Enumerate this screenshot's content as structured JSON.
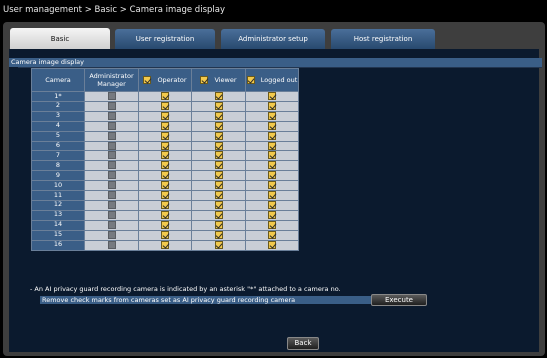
{
  "breadcrumb": "User management > Basic > Camera image display",
  "tabs": [
    {
      "label": "Basic",
      "active": true
    },
    {
      "label": "User registration",
      "active": false
    },
    {
      "label": "Administrator setup",
      "active": false
    },
    {
      "label": "Host registration",
      "active": false
    }
  ],
  "section_title": "Camera image display",
  "table": {
    "columns": {
      "camera": "Camera",
      "admin_line1": "Administrator",
      "admin_line2": "Manager",
      "operator": "Operator",
      "viewer": "Viewer",
      "logged_out": "Logged out"
    },
    "rows": [
      {
        "camera": "1*",
        "admin": false,
        "operator": true,
        "viewer": true,
        "logged_out": true
      },
      {
        "camera": "2",
        "admin": false,
        "operator": true,
        "viewer": true,
        "logged_out": true
      },
      {
        "camera": "3",
        "admin": false,
        "operator": true,
        "viewer": true,
        "logged_out": true
      },
      {
        "camera": "4",
        "admin": false,
        "operator": true,
        "viewer": true,
        "logged_out": true
      },
      {
        "camera": "5",
        "admin": false,
        "operator": true,
        "viewer": true,
        "logged_out": true
      },
      {
        "camera": "6",
        "admin": false,
        "operator": true,
        "viewer": true,
        "logged_out": true
      },
      {
        "camera": "7",
        "admin": false,
        "operator": true,
        "viewer": true,
        "logged_out": true
      },
      {
        "camera": "8",
        "admin": false,
        "operator": true,
        "viewer": true,
        "logged_out": true
      },
      {
        "camera": "9",
        "admin": false,
        "operator": true,
        "viewer": true,
        "logged_out": true
      },
      {
        "camera": "10",
        "admin": false,
        "operator": true,
        "viewer": true,
        "logged_out": true
      },
      {
        "camera": "11",
        "admin": false,
        "operator": true,
        "viewer": true,
        "logged_out": true
      },
      {
        "camera": "12",
        "admin": false,
        "operator": true,
        "viewer": true,
        "logged_out": true
      },
      {
        "camera": "13",
        "admin": false,
        "operator": true,
        "viewer": true,
        "logged_out": true
      },
      {
        "camera": "14",
        "admin": false,
        "operator": true,
        "viewer": true,
        "logged_out": true
      },
      {
        "camera": "15",
        "admin": false,
        "operator": true,
        "viewer": true,
        "logged_out": true
      },
      {
        "camera": "16",
        "admin": false,
        "operator": true,
        "viewer": true,
        "logged_out": true
      }
    ]
  },
  "note": "- An AI privacy guard recording camera is indicated by an asterisk \"*\" attached to a camera no.",
  "execute_row_label": "Remove check marks from cameras set as AI privacy guard recording camera",
  "execute_button": "Execute",
  "back_button": "Back",
  "colors": {
    "header_blue": "#3a5e87",
    "checkbox_on": "#f2c94c",
    "checkbox_off": "#767a80"
  }
}
